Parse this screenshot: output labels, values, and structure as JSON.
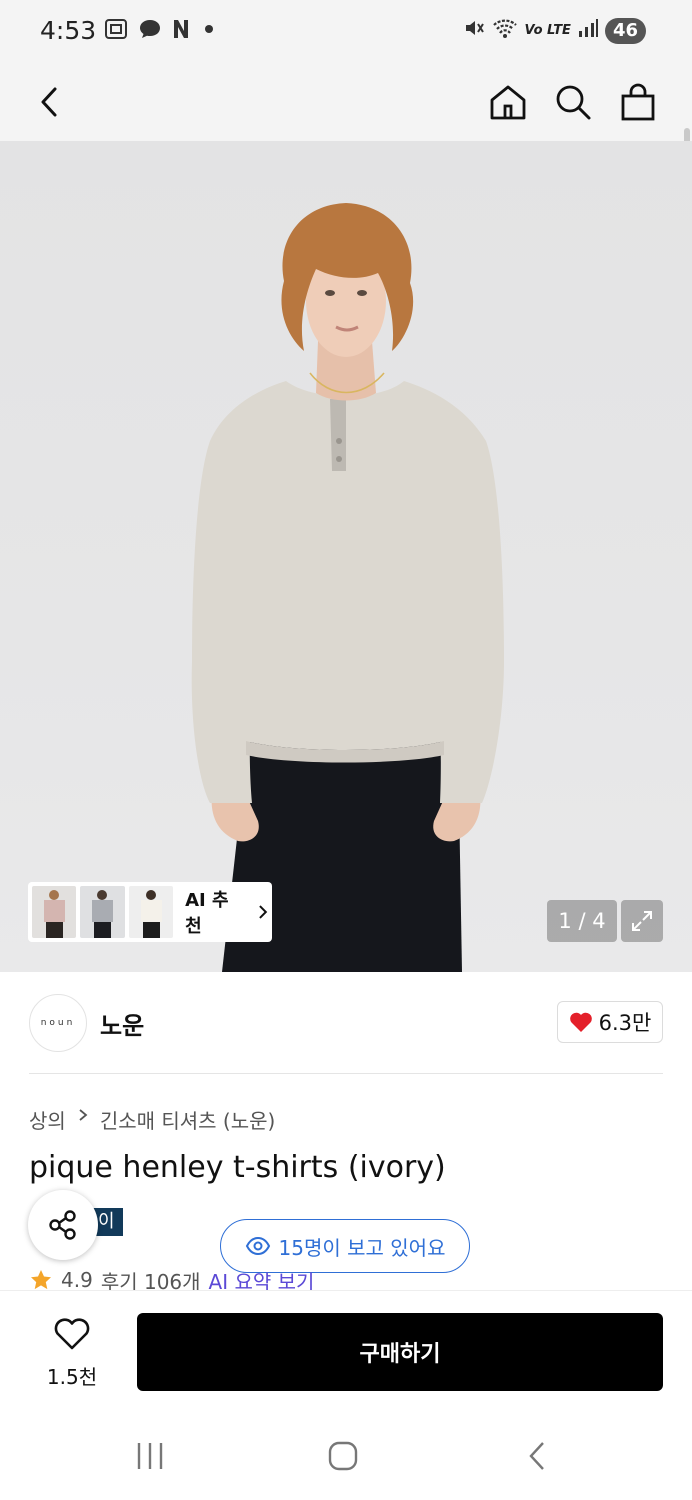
{
  "status_bar": {
    "time": "4:53",
    "left_icons": [
      "screenshot-icon",
      "chat-icon",
      "n-app-icon",
      "dot-icon"
    ],
    "right_icons": [
      "mute-icon",
      "wifi-icon",
      "volte-icon",
      "signal-icon"
    ],
    "network": "Vo LTE",
    "battery": "46"
  },
  "header": {
    "icons": [
      "back-icon",
      "home-icon",
      "search-icon",
      "bag-icon"
    ]
  },
  "gallery": {
    "ai_recommend_label": "AI 추천",
    "thumbnail_count": 3,
    "counter": "1 / 4"
  },
  "brand": {
    "logo_text": "noun",
    "name": "노운",
    "like_count": "6.3만"
  },
  "product": {
    "breadcrumb": [
      "상의",
      "긴소매 티셔츠 (노운)"
    ],
    "title": "pique henley t-shirts (ivory)",
    "badge": "이",
    "viewers": "15명이 보고 있어요",
    "rating": "4.9",
    "reviews": "후기 106개",
    "ai_summary": "AI 요약 보기"
  },
  "buy_bar": {
    "wish_count": "1.5천",
    "buy_label": "구매하기"
  },
  "colors": {
    "accent_blue": "#2f6fd6",
    "heart_red": "#e4202a",
    "star": "#f4a52a",
    "badge_bg": "#123a5a",
    "buy_button": "#000000"
  }
}
